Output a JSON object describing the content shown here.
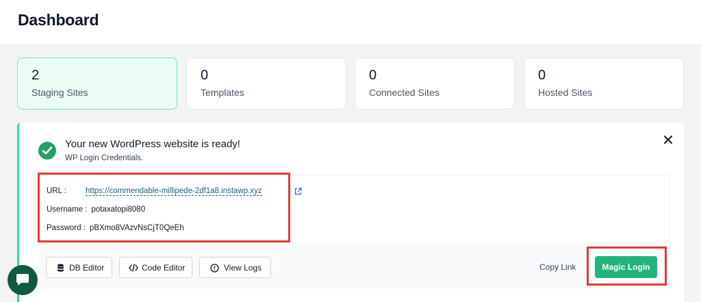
{
  "header": {
    "title": "Dashboard"
  },
  "stats": [
    {
      "value": "2",
      "label": "Staging Sites",
      "active": true
    },
    {
      "value": "0",
      "label": "Templates",
      "active": false
    },
    {
      "value": "0",
      "label": "Connected Sites",
      "active": false
    },
    {
      "value": "0",
      "label": "Hosted Sites",
      "active": false
    }
  ],
  "notice": {
    "title": "Your new WordPress website is ready!",
    "subtitle": "WP Login Credentials.",
    "credentials": {
      "url_label": "URL :",
      "url": "https://commendable-millipede-2df1a8.instawp.xyz",
      "username_label": "Username :",
      "username": "potaxatopi8080",
      "password_label": "Password :",
      "password": "pBXmo8VAzvNsCjT0QeEh"
    },
    "actions": {
      "db_editor": "DB Editor",
      "code_editor": "Code Editor",
      "view_logs": "View Logs",
      "copy_link": "Copy Link",
      "magic_login": "Magic Login"
    }
  },
  "icons": {
    "success": "check-circle-icon",
    "close": "close-icon",
    "external": "external-link-icon",
    "db": "database-icon",
    "code": "code-icon",
    "logs": "info-icon",
    "copy": "clipboard-icon",
    "chat": "chat-icon"
  },
  "colors": {
    "accent": "#1fb57a",
    "active_card_bg": "#ecfdf5",
    "highlight": "#e53935",
    "link": "#1e5f74",
    "chat_bg": "#0f5a43"
  }
}
